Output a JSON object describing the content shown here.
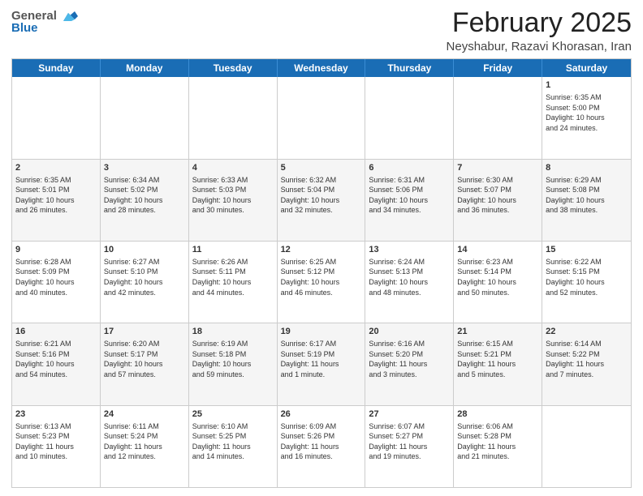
{
  "header": {
    "logo_general": "General",
    "logo_blue": "Blue",
    "title": "February 2025",
    "subtitle": "Neyshabur, Razavi Khorasan, Iran"
  },
  "days_of_week": [
    "Sunday",
    "Monday",
    "Tuesday",
    "Wednesday",
    "Thursday",
    "Friday",
    "Saturday"
  ],
  "weeks": [
    {
      "shaded": false,
      "cells": [
        {
          "day": "",
          "empty": true
        },
        {
          "day": "",
          "empty": true
        },
        {
          "day": "",
          "empty": true
        },
        {
          "day": "",
          "empty": true
        },
        {
          "day": "",
          "empty": true
        },
        {
          "day": "",
          "empty": true
        },
        {
          "day": "1",
          "text": "Sunrise: 6:35 AM\nSunset: 5:00 PM\nDaylight: 10 hours\nand 24 minutes."
        }
      ]
    },
    {
      "shaded": true,
      "cells": [
        {
          "day": "2",
          "text": "Sunrise: 6:35 AM\nSunset: 5:01 PM\nDaylight: 10 hours\nand 26 minutes."
        },
        {
          "day": "3",
          "text": "Sunrise: 6:34 AM\nSunset: 5:02 PM\nDaylight: 10 hours\nand 28 minutes."
        },
        {
          "day": "4",
          "text": "Sunrise: 6:33 AM\nSunset: 5:03 PM\nDaylight: 10 hours\nand 30 minutes."
        },
        {
          "day": "5",
          "text": "Sunrise: 6:32 AM\nSunset: 5:04 PM\nDaylight: 10 hours\nand 32 minutes."
        },
        {
          "day": "6",
          "text": "Sunrise: 6:31 AM\nSunset: 5:06 PM\nDaylight: 10 hours\nand 34 minutes."
        },
        {
          "day": "7",
          "text": "Sunrise: 6:30 AM\nSunset: 5:07 PM\nDaylight: 10 hours\nand 36 minutes."
        },
        {
          "day": "8",
          "text": "Sunrise: 6:29 AM\nSunset: 5:08 PM\nDaylight: 10 hours\nand 38 minutes."
        }
      ]
    },
    {
      "shaded": false,
      "cells": [
        {
          "day": "9",
          "text": "Sunrise: 6:28 AM\nSunset: 5:09 PM\nDaylight: 10 hours\nand 40 minutes."
        },
        {
          "day": "10",
          "text": "Sunrise: 6:27 AM\nSunset: 5:10 PM\nDaylight: 10 hours\nand 42 minutes."
        },
        {
          "day": "11",
          "text": "Sunrise: 6:26 AM\nSunset: 5:11 PM\nDaylight: 10 hours\nand 44 minutes."
        },
        {
          "day": "12",
          "text": "Sunrise: 6:25 AM\nSunset: 5:12 PM\nDaylight: 10 hours\nand 46 minutes."
        },
        {
          "day": "13",
          "text": "Sunrise: 6:24 AM\nSunset: 5:13 PM\nDaylight: 10 hours\nand 48 minutes."
        },
        {
          "day": "14",
          "text": "Sunrise: 6:23 AM\nSunset: 5:14 PM\nDaylight: 10 hours\nand 50 minutes."
        },
        {
          "day": "15",
          "text": "Sunrise: 6:22 AM\nSunset: 5:15 PM\nDaylight: 10 hours\nand 52 minutes."
        }
      ]
    },
    {
      "shaded": true,
      "cells": [
        {
          "day": "16",
          "text": "Sunrise: 6:21 AM\nSunset: 5:16 PM\nDaylight: 10 hours\nand 54 minutes."
        },
        {
          "day": "17",
          "text": "Sunrise: 6:20 AM\nSunset: 5:17 PM\nDaylight: 10 hours\nand 57 minutes."
        },
        {
          "day": "18",
          "text": "Sunrise: 6:19 AM\nSunset: 5:18 PM\nDaylight: 10 hours\nand 59 minutes."
        },
        {
          "day": "19",
          "text": "Sunrise: 6:17 AM\nSunset: 5:19 PM\nDaylight: 11 hours\nand 1 minute."
        },
        {
          "day": "20",
          "text": "Sunrise: 6:16 AM\nSunset: 5:20 PM\nDaylight: 11 hours\nand 3 minutes."
        },
        {
          "day": "21",
          "text": "Sunrise: 6:15 AM\nSunset: 5:21 PM\nDaylight: 11 hours\nand 5 minutes."
        },
        {
          "day": "22",
          "text": "Sunrise: 6:14 AM\nSunset: 5:22 PM\nDaylight: 11 hours\nand 7 minutes."
        }
      ]
    },
    {
      "shaded": false,
      "cells": [
        {
          "day": "23",
          "text": "Sunrise: 6:13 AM\nSunset: 5:23 PM\nDaylight: 11 hours\nand 10 minutes."
        },
        {
          "day": "24",
          "text": "Sunrise: 6:11 AM\nSunset: 5:24 PM\nDaylight: 11 hours\nand 12 minutes."
        },
        {
          "day": "25",
          "text": "Sunrise: 6:10 AM\nSunset: 5:25 PM\nDaylight: 11 hours\nand 14 minutes."
        },
        {
          "day": "26",
          "text": "Sunrise: 6:09 AM\nSunset: 5:26 PM\nDaylight: 11 hours\nand 16 minutes."
        },
        {
          "day": "27",
          "text": "Sunrise: 6:07 AM\nSunset: 5:27 PM\nDaylight: 11 hours\nand 19 minutes."
        },
        {
          "day": "28",
          "text": "Sunrise: 6:06 AM\nSunset: 5:28 PM\nDaylight: 11 hours\nand 21 minutes."
        },
        {
          "day": "",
          "empty": true
        }
      ]
    }
  ]
}
